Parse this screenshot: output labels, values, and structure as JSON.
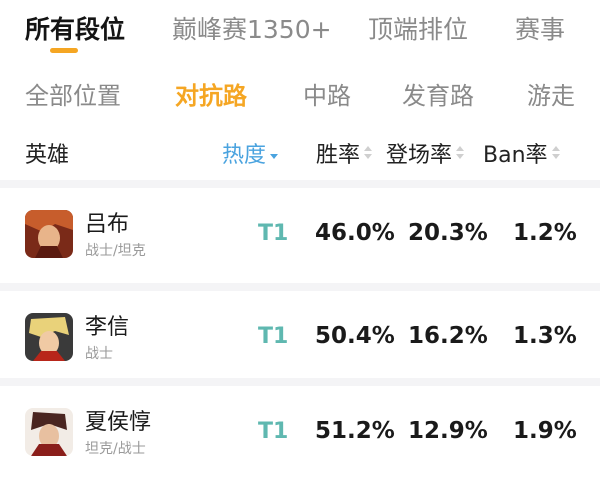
{
  "rank_tabs": [
    "所有段位",
    "巅峰赛1350+",
    "顶端排位",
    "赛事"
  ],
  "lane_tabs": [
    "全部位置",
    "对抗路",
    "中路",
    "发育路",
    "游走"
  ],
  "columns": {
    "hero": "英雄",
    "hot": "热度",
    "win": "胜率",
    "pick": "登场率",
    "ban": "Ban率"
  },
  "colors": {
    "accent": "#f5a623",
    "active_sort": "#4aa3df",
    "tier": "#5fb8b0"
  },
  "heroes": [
    {
      "name": "吕布",
      "role": "战士/坦克",
      "tier": "T1",
      "win": "46.0%",
      "pick": "20.3%",
      "ban": "1.2%"
    },
    {
      "name": "李信",
      "role": "战士",
      "tier": "T1",
      "win": "50.4%",
      "pick": "16.2%",
      "ban": "1.3%"
    },
    {
      "name": "夏侯惇",
      "role": "坦克/战士",
      "tier": "T1",
      "win": "51.2%",
      "pick": "12.9%",
      "ban": "1.9%"
    }
  ]
}
